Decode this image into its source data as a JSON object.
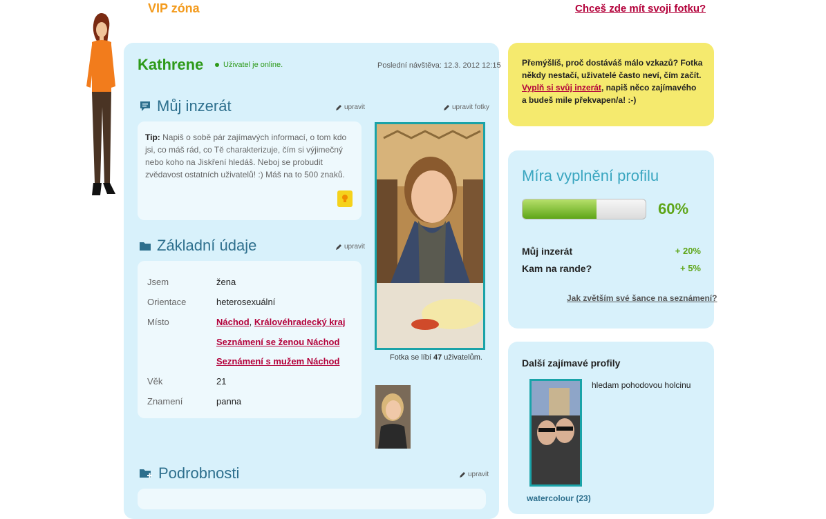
{
  "top": {
    "vip_label": "VIP zóna",
    "photo_prompt": "Chceš zde mít svoji fotku?"
  },
  "profile": {
    "name": "Kathrene",
    "online_text": "Uživatel je online.",
    "last_visit": "Poslední návštěva: 12.3. 2012 12:15",
    "edit_label": "upravit",
    "edit_photos_label": "upravit fotky"
  },
  "ad_section": {
    "title": "Můj inzerát",
    "tip_bold": "Tip:",
    "tip_text": " Napiš o sobě pár zajímavých informací, o tom kdo jsi, co máš rád, co Tě charakterizuje, čím si výjimečný nebo koho na Jiskření hledáš. Neboj se probudit zvědavost ostatních uživatelů! :) Máš na to 500 znaků."
  },
  "basic_section": {
    "title": "Základní údaje",
    "rows": {
      "jsem": {
        "label": "Jsem",
        "value": "žena"
      },
      "orientace": {
        "label": "Orientace",
        "value": "heterosexuální"
      },
      "misto": {
        "label": "Místo",
        "town": "Náchod",
        "sep": ", ",
        "region": "Královéhradecký kraj",
        "link1": "Seznámení se ženou Náchod",
        "link2": "Seznámení s mužem Náchod"
      },
      "vek": {
        "label": "Věk",
        "value": "21"
      },
      "znameni": {
        "label": "Znamení",
        "value": "panna"
      }
    }
  },
  "photo": {
    "likes_prefix": "Fotka se líbí ",
    "likes_count": "47",
    "likes_suffix": " uživatelům."
  },
  "details_section": {
    "title": "Podrobnosti"
  },
  "hint_box": {
    "text": "Přemýšlíš, proč dostáváš málo vzkazů? Fotka někdy nestačí, uživatelé často neví, čím začít. ",
    "link": "Vyplň si svůj inzerát",
    "text_after": ", napiš něco zajímavého a budeš mile překvapen/a! :-)"
  },
  "completion": {
    "title": "Míra vyplnění profilu",
    "percent_label": "60%",
    "percent_value": 0.6,
    "items": [
      {
        "label": "Můj inzerát",
        "bonus": "+ 20%"
      },
      {
        "label": "Kam na rande?",
        "bonus": "+ 5%"
      }
    ],
    "link": "Jak zvětším své šance na seznámení?"
  },
  "other_profiles": {
    "title": "Další zajímavé profily",
    "item": {
      "tagline": "hledam pohodovou holcinu",
      "name": "watercolour (23)"
    }
  },
  "colors": {
    "accent_green": "#2e9a1a",
    "link_red": "#b3003a",
    "panel_blue": "#d8f1fb",
    "hint_yellow": "#f5ea6e"
  }
}
